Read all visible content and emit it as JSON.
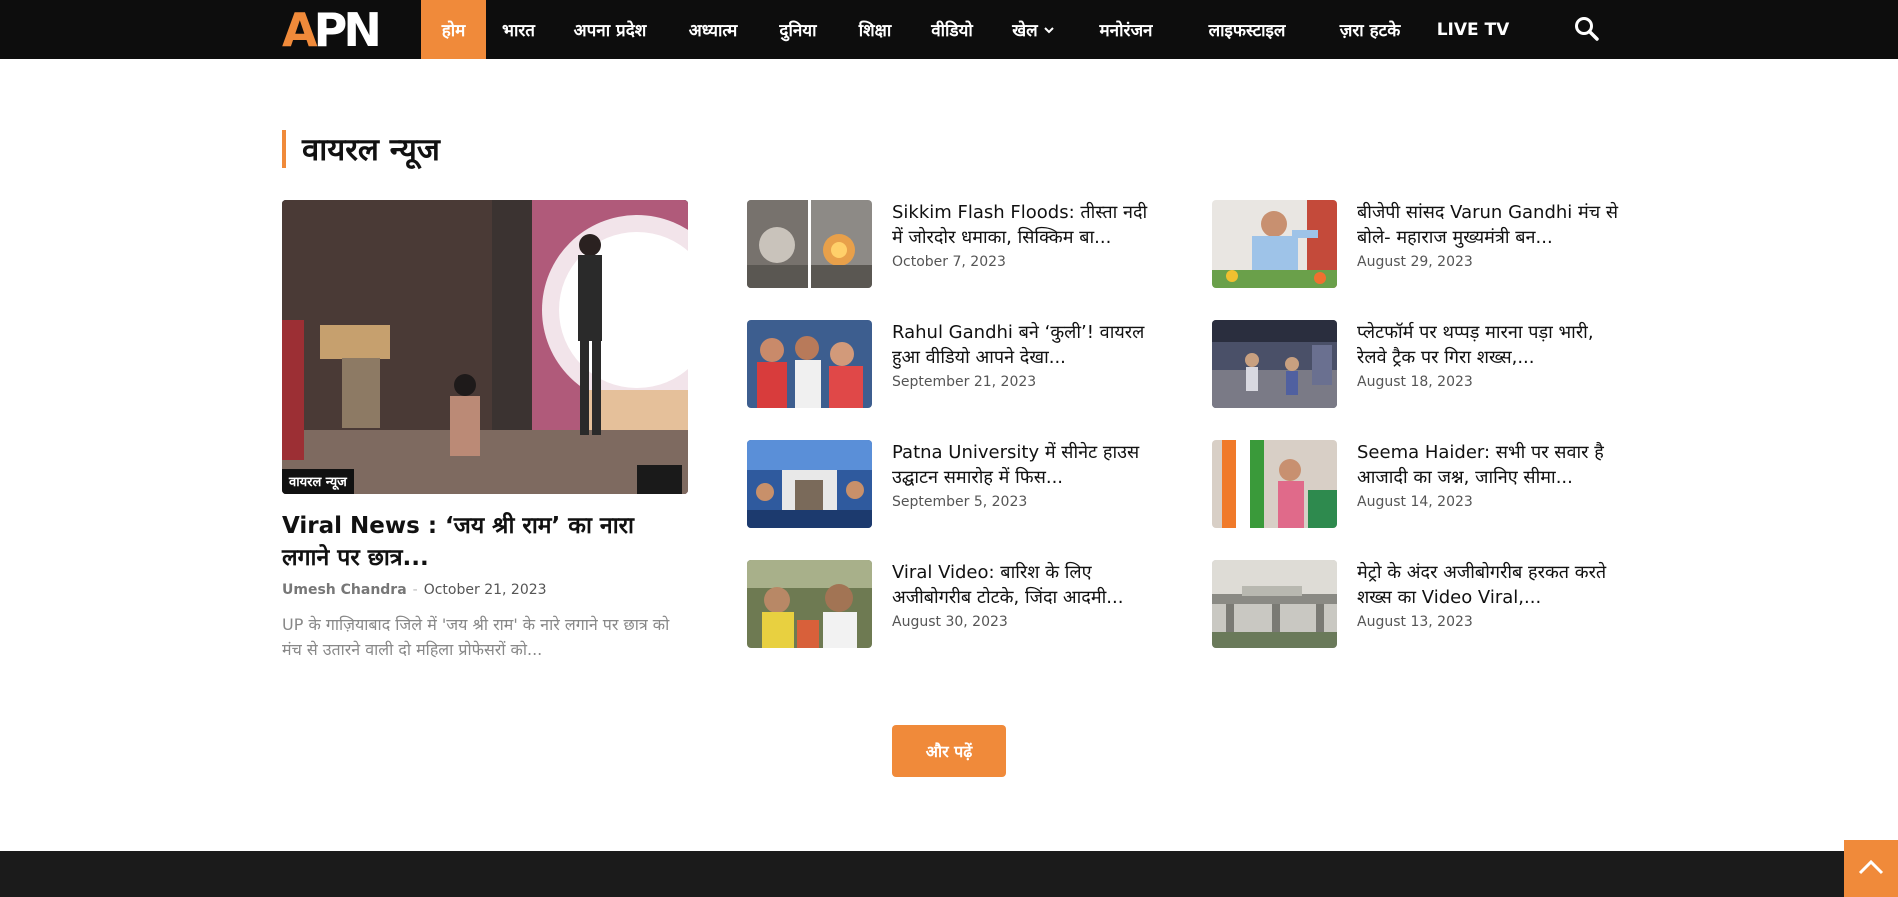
{
  "colors": {
    "accent": "#f08a3a",
    "nav_bg": "#0d0d0d",
    "footer_bg": "#1b1b1b"
  },
  "logo": {
    "part_a": "A",
    "part_pn": "PN"
  },
  "nav": {
    "items": [
      {
        "label": "होम",
        "active": true
      },
      {
        "label": "भारत"
      },
      {
        "label": "अपना प्रदेश"
      },
      {
        "label": "अध्यात्म"
      },
      {
        "label": "दुनिया"
      },
      {
        "label": "शिक्षा"
      },
      {
        "label": "वीडियो"
      },
      {
        "label": "खेल",
        "dropdown": true
      },
      {
        "label": "मनोरंजन"
      },
      {
        "label": "लाइफस्टाइल"
      },
      {
        "label": "ज़रा हटके"
      },
      {
        "label": "LIVE TV"
      }
    ],
    "search_icon": "search-icon"
  },
  "section": {
    "title": "वायरल न्यूज"
  },
  "featured": {
    "category": "वायरल न्यूज",
    "title": "Viral News : ‘जय श्री राम’ का नारा लगाने पर छात्र...",
    "author": "Umesh Chandra",
    "separator": "-",
    "date": "October 21, 2023",
    "excerpt": "UP के गाज़ियाबाद जिले में 'जय श्री राम' के नारे लगाने पर छात्र को मंच से उतारने वाली दो महिला प्रोफेसरों को..."
  },
  "list_left": [
    {
      "title": "Sikkim Flash Floods: तीस्ता नदी में जोरदोर धमाका, सिक्किम बा...",
      "date": "October 7, 2023"
    },
    {
      "title": "Rahul Gandhi बने ‘कुली’! वायरल हुआ वीडियो आपने देखा...",
      "date": "September 21, 2023"
    },
    {
      "title": "Patna University में सीनेट हाउस उद्घाटन समारोह में फिस...",
      "date": "September 5, 2023"
    },
    {
      "title": "Viral Video: बारिश के लिए अजीबोगरीब टोटके, जिंदा आदमी...",
      "date": "August 30, 2023"
    }
  ],
  "list_right": [
    {
      "title": "बीजेपी सांसद Varun Gandhi मंच से बोले- महाराज मुख्यमंत्री बन...",
      "date": "August 29, 2023"
    },
    {
      "title": "प्लेटफॉर्म पर थप्पड़ मारना पड़ा भारी, रेलवे ट्रैक पर गिरा शख्स,...",
      "date": "August 18, 2023"
    },
    {
      "title": "Seema Haider: सभी पर सवार है आजादी का जश्न, जानिए सीमा...",
      "date": "August 14, 2023"
    },
    {
      "title": "मेट्रो के अंदर अजीबोगरीब हरकत करते शख्स का Video Viral,...",
      "date": "August 13, 2023"
    }
  ],
  "more_button": "और पढ़ें"
}
